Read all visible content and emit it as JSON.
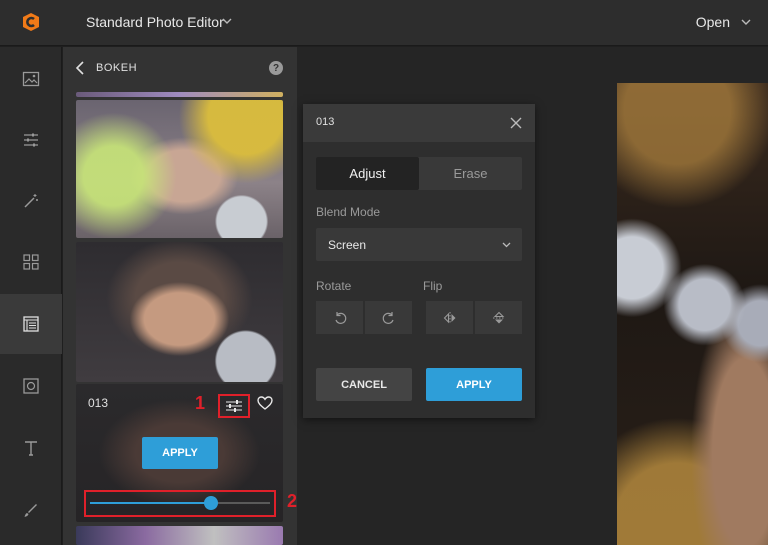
{
  "app": {
    "title": "Standard Photo Editor",
    "open_label": "Open",
    "accent": "#2e9ed8",
    "annotation_color": "#e0202a"
  },
  "rail": {
    "items": [
      {
        "name": "image-icon"
      },
      {
        "name": "sliders-icon"
      },
      {
        "name": "magic-wand-icon"
      },
      {
        "name": "grid-icon"
      },
      {
        "name": "texture-icon",
        "active": true
      },
      {
        "name": "frame-icon"
      },
      {
        "name": "text-icon"
      },
      {
        "name": "brush-icon"
      }
    ]
  },
  "panel": {
    "title": "BOKEH",
    "help": "?",
    "selected_thumb": {
      "label": "013",
      "apply_label": "APPLY",
      "intensity": 0.67
    },
    "annotations": [
      "1",
      "2"
    ]
  },
  "dialog": {
    "title": "013",
    "tabs": [
      "Adjust",
      "Erase"
    ],
    "active_tab": "Adjust",
    "blend_mode_label": "Blend Mode",
    "blend_mode_value": "Screen",
    "rotate_label": "Rotate",
    "flip_label": "Flip",
    "cancel_label": "CANCEL",
    "apply_label": "APPLY"
  }
}
